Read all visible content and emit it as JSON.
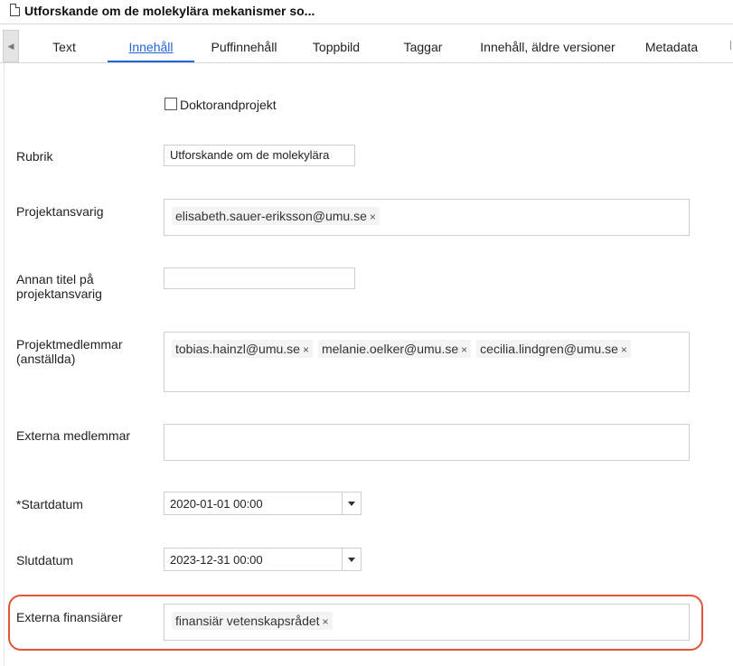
{
  "header": {
    "title": "Utforskande om de molekylära mekanismer so..."
  },
  "tabs": [
    {
      "label": "Text"
    },
    {
      "label": "Innehåll"
    },
    {
      "label": "Puffinnehåll"
    },
    {
      "label": "Toppbild"
    },
    {
      "label": "Taggar"
    },
    {
      "label": "Innehåll, äldre versioner"
    },
    {
      "label": "Metadata"
    }
  ],
  "form": {
    "doktorand_label": "Doktorandprojekt",
    "rubrik_label": "Rubrik",
    "rubrik_value": "Utforskande om de molekylära",
    "projektansvarig_label": "Projektansvarig",
    "projektansvarig_tokens": [
      "elisabeth.sauer-eriksson@umu.se"
    ],
    "annan_titel_label_1": "Annan titel på",
    "annan_titel_label_2": "projektansvarig",
    "medlemmar_label_1": "Projektmedlemmar",
    "medlemmar_label_2": "(anställda)",
    "medlemmar_tokens": [
      "tobias.hainzl@umu.se",
      "melanie.oelker@umu.se",
      "cecilia.lindgren@umu.se"
    ],
    "externa_medlemmar_label": "Externa medlemmar",
    "startdatum_label": "*Startdatum",
    "startdatum_value": "2020-01-01 00:00",
    "slutdatum_label": "Slutdatum",
    "slutdatum_value": "2023-12-31 00:00",
    "finansiarer_label": "Externa finansiärer",
    "finansiarer_tokens": [
      "finansiär vetenskapsrådet"
    ],
    "remove_glyph": "×"
  },
  "colors": {
    "accent": "#2166d6",
    "highlight": "#e2553a"
  }
}
